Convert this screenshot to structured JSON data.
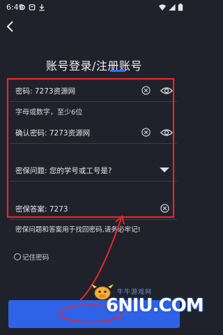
{
  "status": {
    "time": "6:49"
  },
  "header": {
    "title": "账号登录/注册账号"
  },
  "form": {
    "password": "密码: 7273资源网",
    "password_hint": "字母或数字，至少6位",
    "confirm_password": "确认密码: 7273资源网",
    "security_question": "密保问题: 您的学号或工号是?",
    "security_answer": "密保答案: 7273",
    "note": "密保问题和答案用于找回密码,请务必牢记!",
    "remember": "记住密码"
  },
  "watermark": {
    "text": "6NIU.COM",
    "subtitle": "牛牛游戏网"
  },
  "colors": {
    "background": "#1f222b",
    "accent": "#2e63e8",
    "annotation": "#e8262b"
  }
}
